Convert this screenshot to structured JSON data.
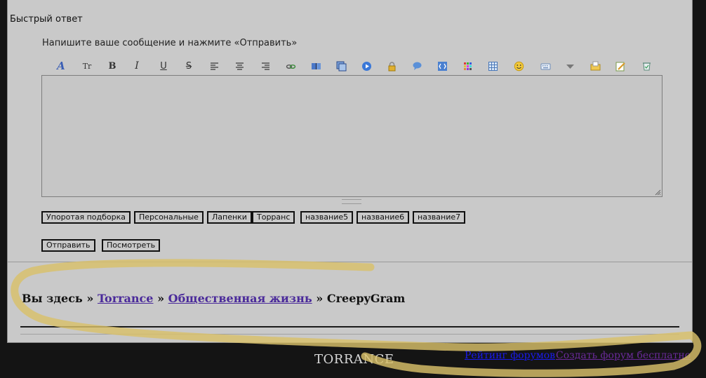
{
  "quick_reply": {
    "title": "Быстрый ответ",
    "hint": "Напишите ваше сообщение и нажмите «Отправить»"
  },
  "toolbar": {
    "items": [
      {
        "name": "font-face-icon",
        "glyph": "A"
      },
      {
        "name": "font-size-icon",
        "glyph": "Tr"
      },
      {
        "name": "bold-icon",
        "glyph": "B"
      },
      {
        "name": "italic-icon",
        "glyph": "I"
      },
      {
        "name": "underline-icon",
        "glyph": "U"
      },
      {
        "name": "strikethrough-icon",
        "glyph": "S"
      },
      {
        "name": "align-left-icon",
        "glyph": ""
      },
      {
        "name": "align-center-icon",
        "glyph": ""
      },
      {
        "name": "align-right-icon",
        "glyph": ""
      },
      {
        "name": "link-icon",
        "glyph": ""
      },
      {
        "name": "book-icon",
        "glyph": ""
      },
      {
        "name": "image-icon",
        "glyph": ""
      },
      {
        "name": "video-icon",
        "glyph": ""
      },
      {
        "name": "lock-icon",
        "glyph": ""
      },
      {
        "name": "quote-icon",
        "glyph": ""
      },
      {
        "name": "code-icon",
        "glyph": ""
      },
      {
        "name": "color-icon",
        "glyph": ""
      },
      {
        "name": "table-icon",
        "glyph": ""
      },
      {
        "name": "smiley-icon",
        "glyph": ""
      },
      {
        "name": "keyboard-icon",
        "glyph": ""
      },
      {
        "name": "dropdown-arrow-icon",
        "glyph": ""
      },
      {
        "name": "upload-icon",
        "glyph": ""
      },
      {
        "name": "edit-icon",
        "glyph": ""
      },
      {
        "name": "clear-icon",
        "glyph": ""
      }
    ]
  },
  "tag_buttons": [
    "Упоротая подборка",
    "Персональные",
    "Лапенки",
    "Торранс",
    "название5",
    "название6",
    "название7"
  ],
  "actions": {
    "send": "Отправить",
    "preview": "Посмотреть"
  },
  "breadcrumb": {
    "prefix": "Вы здесь",
    "sep": "»",
    "links": [
      "Torrance",
      "Общественная жизнь"
    ],
    "current": "CreepyGram"
  },
  "footer": {
    "logo": "TORRANCE",
    "rating_link": "Рейтинг форумов",
    "create_link": "Создать форум бесплатно"
  },
  "colors": {
    "panel_bg": "#c9c9c9",
    "page_bg": "#141414",
    "link_visited": "#4a2a9a",
    "link_blue": "#1a1aee",
    "link_purple": "#6a2a9a",
    "highlight": "#d9c16a"
  }
}
